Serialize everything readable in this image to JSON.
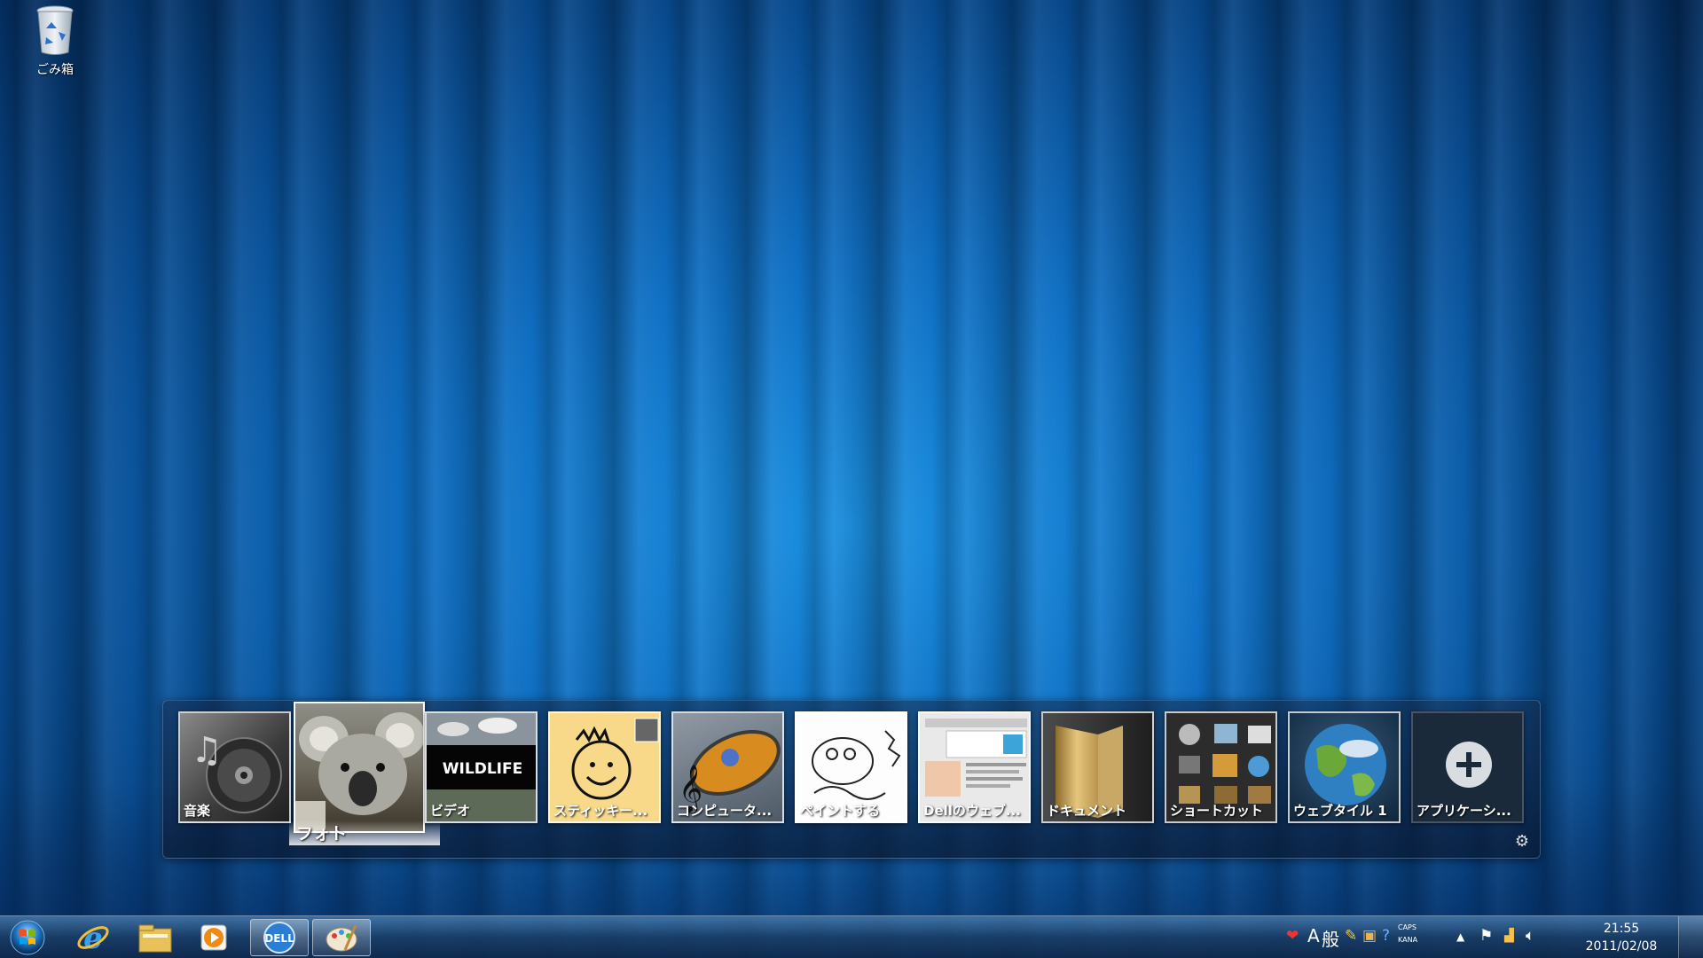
{
  "desktop": {
    "recycle_bin_label": "ごみ箱"
  },
  "dock": {
    "tiles": [
      {
        "label": "音楽",
        "icon": "music-disc-icon"
      },
      {
        "label": "フォト",
        "icon": "koala-photo"
      },
      {
        "label": "ビデオ",
        "icon": "wildlife-video",
        "thumb_text": "WILDLIFE"
      },
      {
        "label": "スティッキー...",
        "icon": "sticky-note-smiley"
      },
      {
        "label": "コンピュータ...",
        "icon": "computer-music-icon"
      },
      {
        "label": "ペイントする",
        "icon": "paint-sketch"
      },
      {
        "label": "Dellのウェブ...",
        "icon": "web-page-thumbnail"
      },
      {
        "label": "ドキュメント",
        "icon": "folder-icon"
      },
      {
        "label": "ショートカット",
        "icon": "shortcut-grid-icon"
      },
      {
        "label": "ウェブタイル 1",
        "icon": "globe-icon"
      },
      {
        "label": "アプリケーシ...",
        "icon": "plus-icon"
      }
    ],
    "settings_icon": "gear-icon"
  },
  "taskbar": {
    "buttons": [
      {
        "name": "internet-explorer",
        "icon": "ie-icon"
      },
      {
        "name": "explorer",
        "icon": "folder-icon"
      },
      {
        "name": "media-player",
        "icon": "media-player-icon"
      },
      {
        "name": "dell-dock",
        "icon": "dell-icon"
      },
      {
        "name": "paint",
        "icon": "palette-icon"
      }
    ],
    "tray": {
      "ime_mode": "A",
      "ime_type": "般",
      "caps": "CAPS",
      "kana": "KANA"
    },
    "clock": {
      "time": "21:55",
      "date": "2011/02/08"
    }
  },
  "colors": {
    "wallpaper": "#0f6fc3",
    "taskbar": "#1c3e64"
  }
}
